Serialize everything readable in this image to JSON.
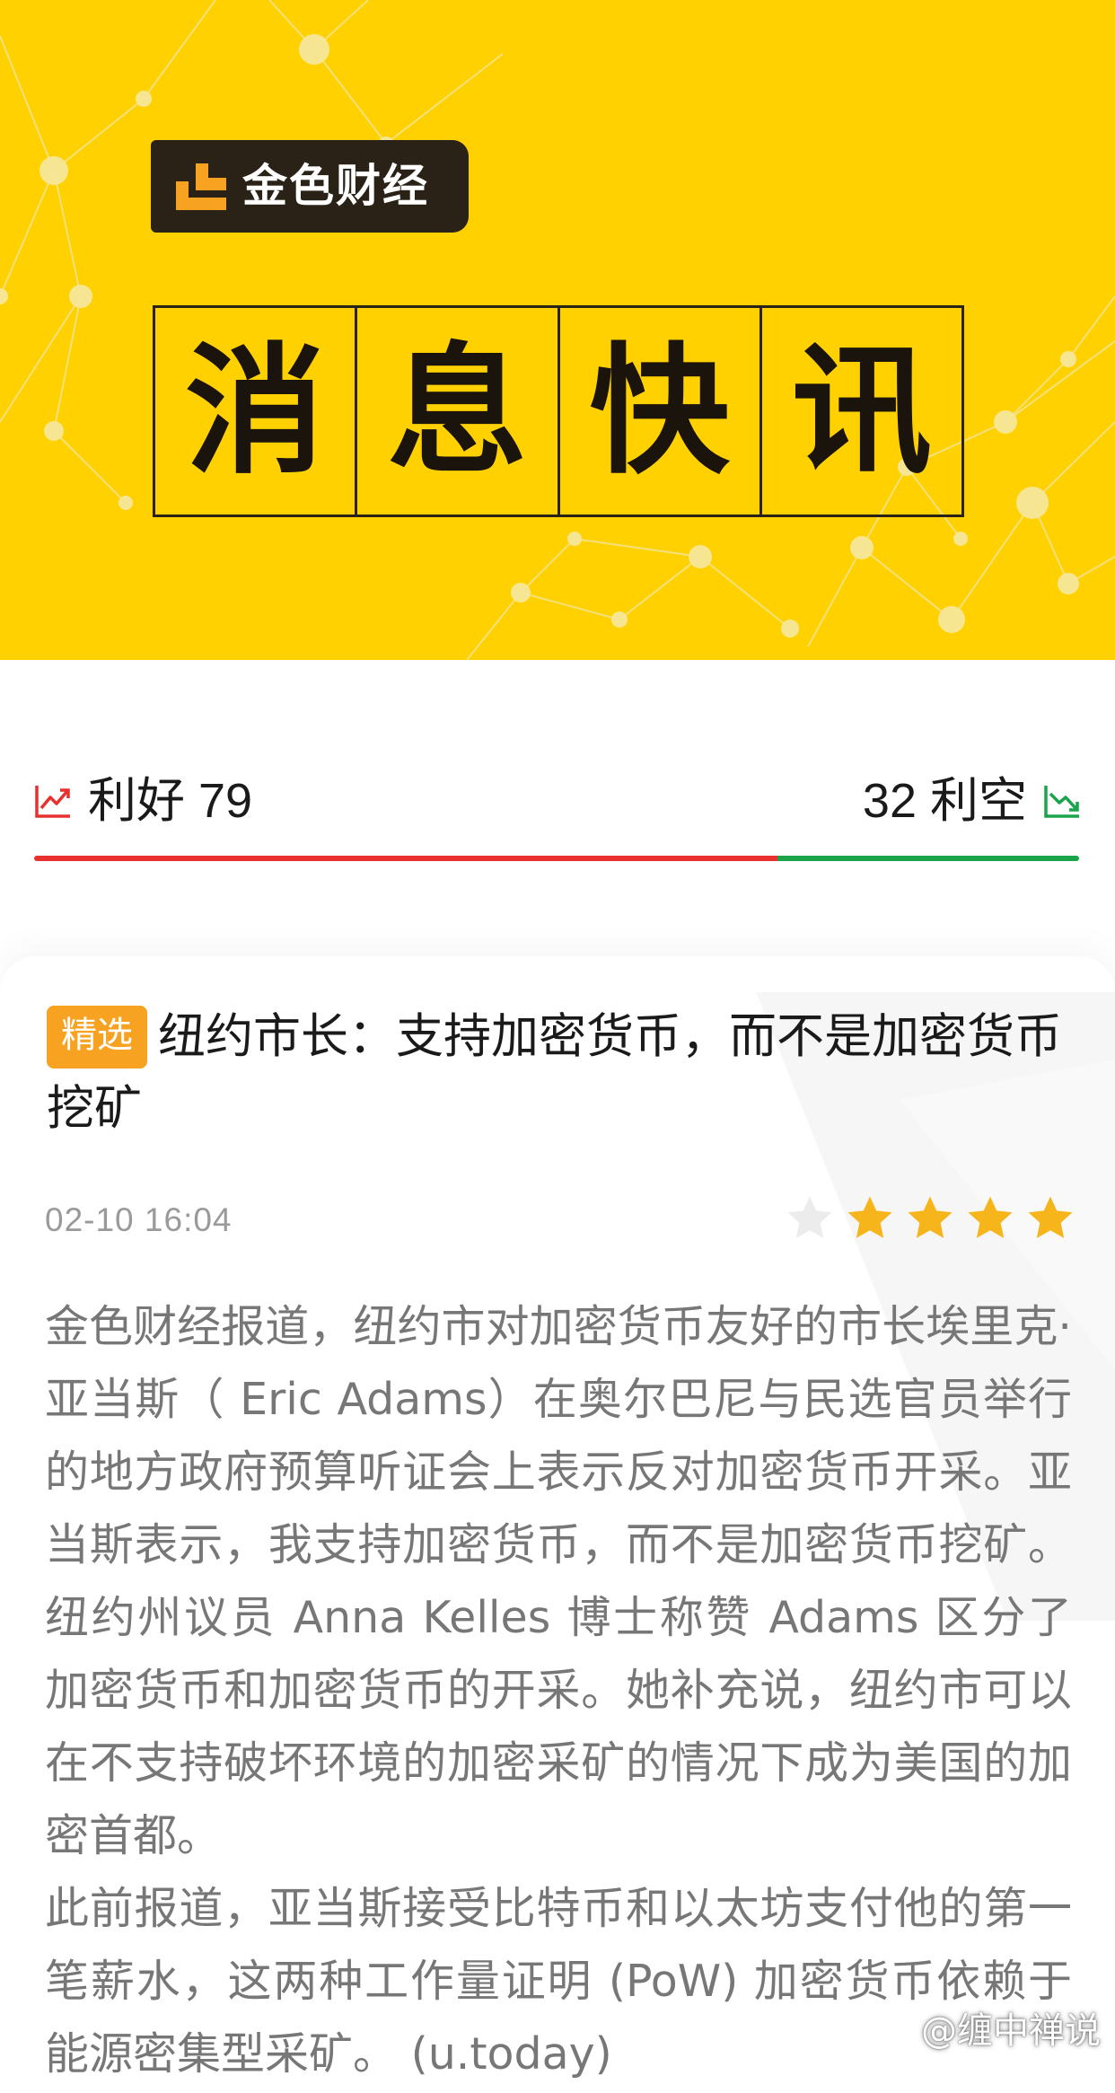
{
  "banner": {
    "logo_text": "金色财经",
    "title_chars": [
      "消",
      "息",
      "快",
      "讯"
    ],
    "colors": {
      "background": "#ffd100",
      "ink": "#2a2216",
      "logo_accent": "#f7a321"
    }
  },
  "sentiment": {
    "bull_label": "利好 79",
    "bear_label": "32 利空",
    "bull_count": 79,
    "bear_count": 32,
    "colors": {
      "bull": "#e8302f",
      "bear": "#1aa34a"
    }
  },
  "article": {
    "tag": "精选",
    "headline": "纽约市长：支持加密货币，而不是加密货币挖矿",
    "time": "02-10 16:04",
    "rating": {
      "filled": 4,
      "total": 5,
      "filled_color": "#f7b51c",
      "empty_color": "#ececec"
    },
    "paragraphs": [
      "金色财经报道，纽约市对加密货币友好的市长埃里克·亚当斯（ Eric Adams）在奥尔巴尼与民选官员举行的地方政府预算听证会上表示反对加密货币开采。亚当斯表示，我支持加密货币，而不是加密货币挖矿。纽约州议员 Anna Kelles 博士称赞 Adams 区分了加密货币和加密货币的开采。她补充说，纽约市可以在不支持破坏环境的加密采矿的情况下成为美国的加密首都。",
      "此前报道，亚当斯接受比特币和以太坊支付他的第一笔薪水，这两种工作量证明 (PoW) 加密货币依赖于能源密集型采矿。 (u.today)"
    ]
  },
  "watermark": {
    "icon": "weibo-icon",
    "text": "@缠中禅说"
  }
}
